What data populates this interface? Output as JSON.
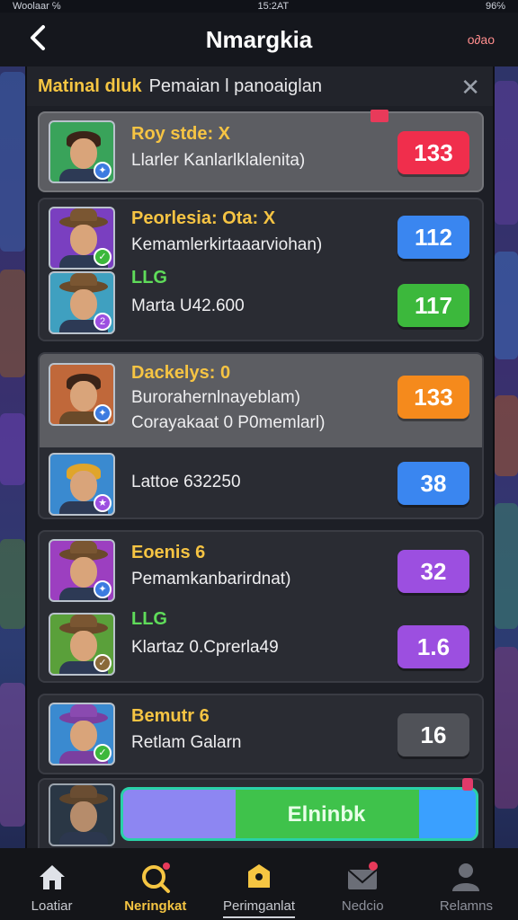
{
  "status_bar": {
    "left": "Woolaar ℅",
    "center": "15:2AT",
    "right": "96℅"
  },
  "header": {
    "back_label": "‹",
    "title": "Nmargkia",
    "code": "o∂ao"
  },
  "panel": {
    "highlight": "Matinal dluk",
    "title": "Pemaian l panoaiglan",
    "close_label": "✕"
  },
  "cards": [
    {
      "rows": [
        {
          "name": "Roy stde: X",
          "desc": "Llarler Kanlarlklalenita)",
          "score": "133",
          "score_color": "#f02e4c"
        }
      ]
    },
    {
      "rows": [
        {
          "name": "Peorlesia: Ota: X",
          "desc": "Kemamlerkirtaaarviohan)",
          "score": "112",
          "score_color": "#3a86f0"
        },
        {
          "name": "LLG",
          "desc": "Marta U42.600",
          "score": "117",
          "score_color": "#3cb83c"
        }
      ]
    },
    {
      "rows": [
        {
          "name": "Dackelys: 0",
          "desc": "Burorahernlnayeblam)",
          "desc2": "Corayakaat 0 P0memlarl)",
          "score": "133",
          "score_color": "#f58a1c"
        },
        {
          "name": "",
          "desc": "Lattoe 632250",
          "score": "38",
          "score_color": "#3a86f0"
        }
      ]
    },
    {
      "rows": [
        {
          "name": "Eoenis 6",
          "desc": "Pemamkanbarirdnat)",
          "score": "32",
          "score_color": "#9c4fe0"
        },
        {
          "name": "LLG",
          "desc": "Klartaz 0.Cprerla49",
          "score": "1.6",
          "score_color": "#9c4fe0"
        }
      ]
    },
    {
      "rows": [
        {
          "name": "Bemutr 6",
          "desc": "Retlam Galarn",
          "score": "16",
          "score_color": "#505258"
        }
      ]
    }
  ],
  "progress": {
    "label": "Elninbk",
    "value_fraction": 0.84
  },
  "nav": [
    {
      "label": "Loatiar",
      "icon": "home-icon"
    },
    {
      "label": "Neringkat",
      "icon": "search-icon"
    },
    {
      "label": "Perimganlat",
      "icon": "bell-icon"
    },
    {
      "label": "Nedcio",
      "icon": "mail-icon"
    },
    {
      "label": "Relamns",
      "icon": "user-icon"
    }
  ],
  "colors": {
    "accent": "#f5c542",
    "green_label": "#5fdc5a"
  }
}
